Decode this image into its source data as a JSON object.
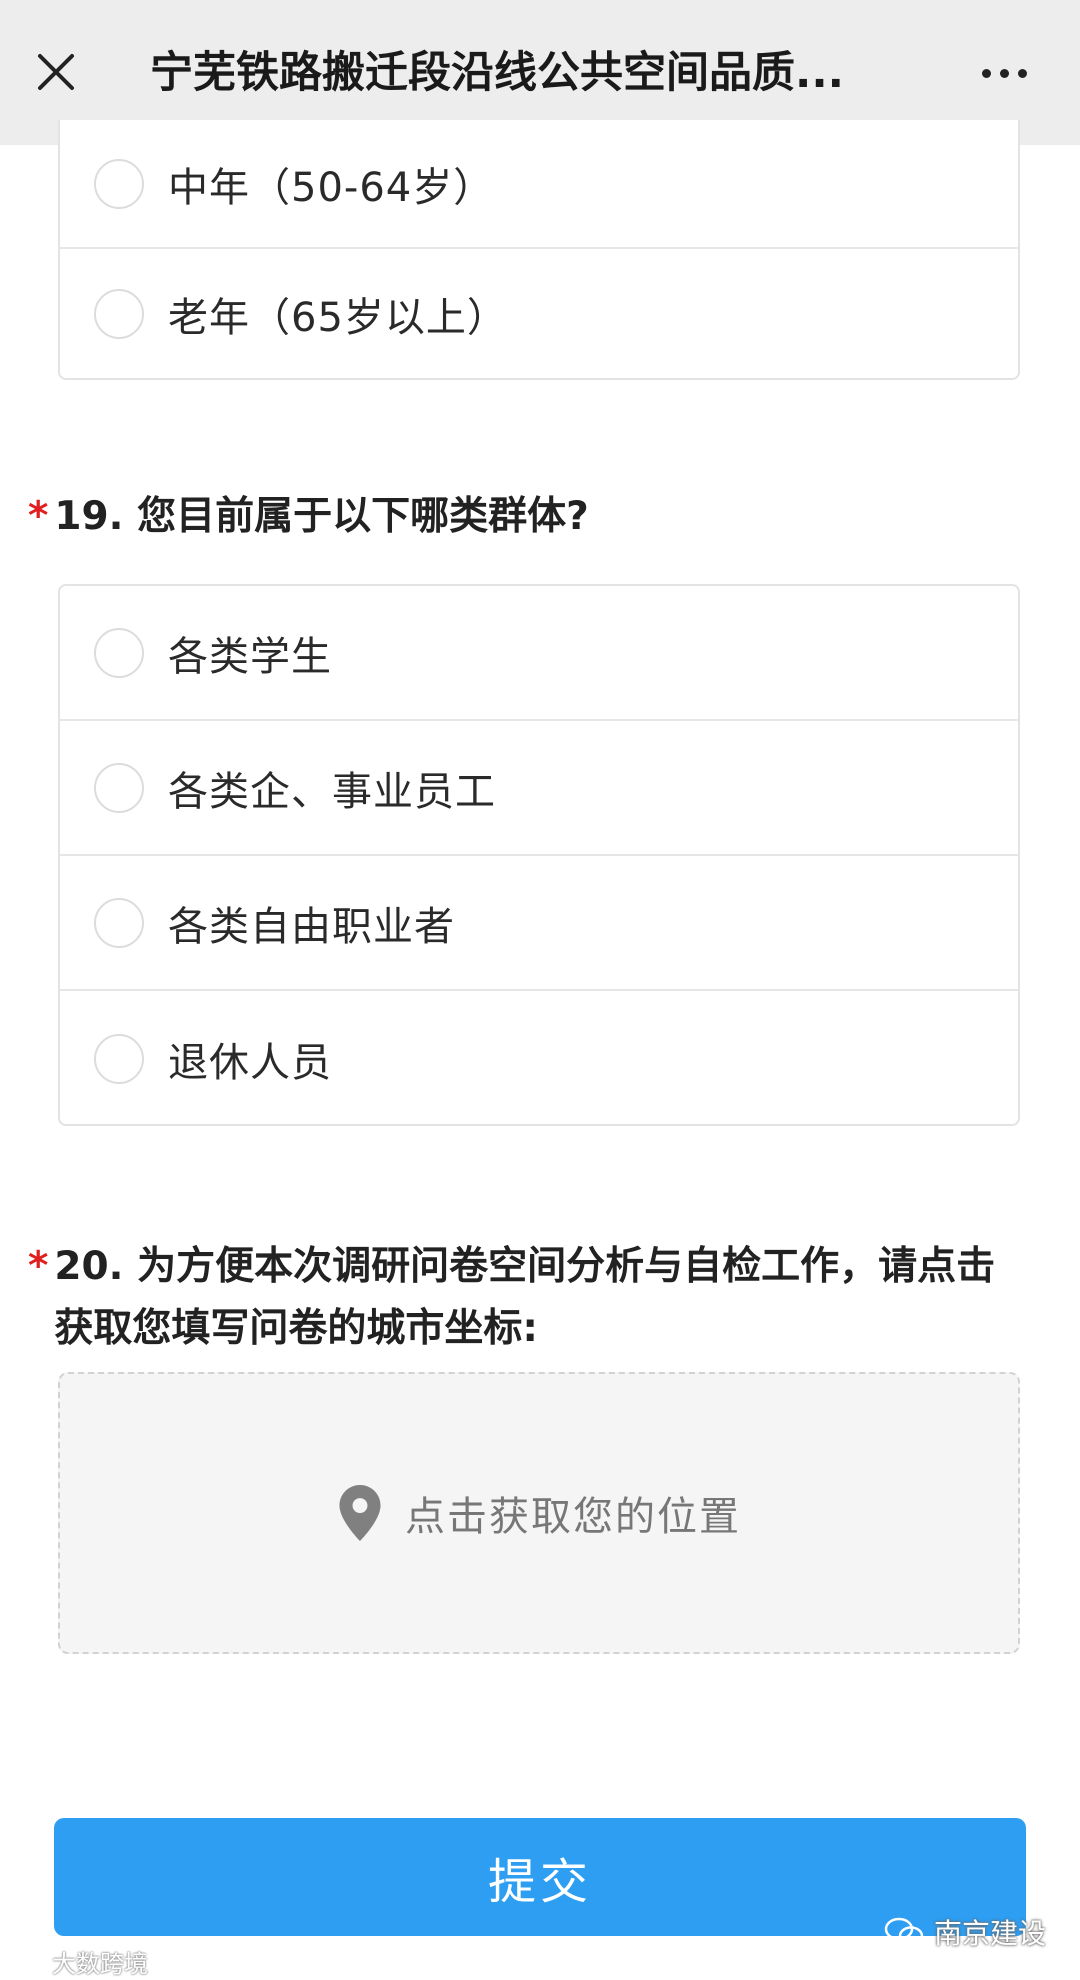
{
  "header": {
    "close_icon": "close-icon",
    "title": "宁芜铁路搬迁段沿线公共空间品质...",
    "more_icon": "more-icon"
  },
  "q18": {
    "options": [
      {
        "label": "中年（50-64岁）",
        "selected": false
      },
      {
        "label": "老年（65岁以上）",
        "selected": false
      }
    ]
  },
  "q19": {
    "required_mark": "*",
    "text": "19. 您目前属于以下哪类群体?",
    "options": [
      {
        "label": "各类学生",
        "selected": false
      },
      {
        "label": "各类企、事业员工",
        "selected": false
      },
      {
        "label": "各类自由职业者",
        "selected": false
      },
      {
        "label": "退休人员",
        "selected": false
      }
    ]
  },
  "q20": {
    "required_mark": "*",
    "text": "20. 为方便本次调研问卷空间分析与自检工作，请点击获取您填写问卷的城市坐标:",
    "location_icon": "map-pin-icon",
    "location_placeholder": "点击获取您的位置"
  },
  "submit": {
    "label": "提交",
    "color": "#2d9ef2"
  },
  "watermarks": {
    "left": "大数跨境",
    "right": "南京建设"
  },
  "colors": {
    "required": "#e02020",
    "header_bg": "#ededed",
    "location_box_bg": "#f5f5f5"
  }
}
